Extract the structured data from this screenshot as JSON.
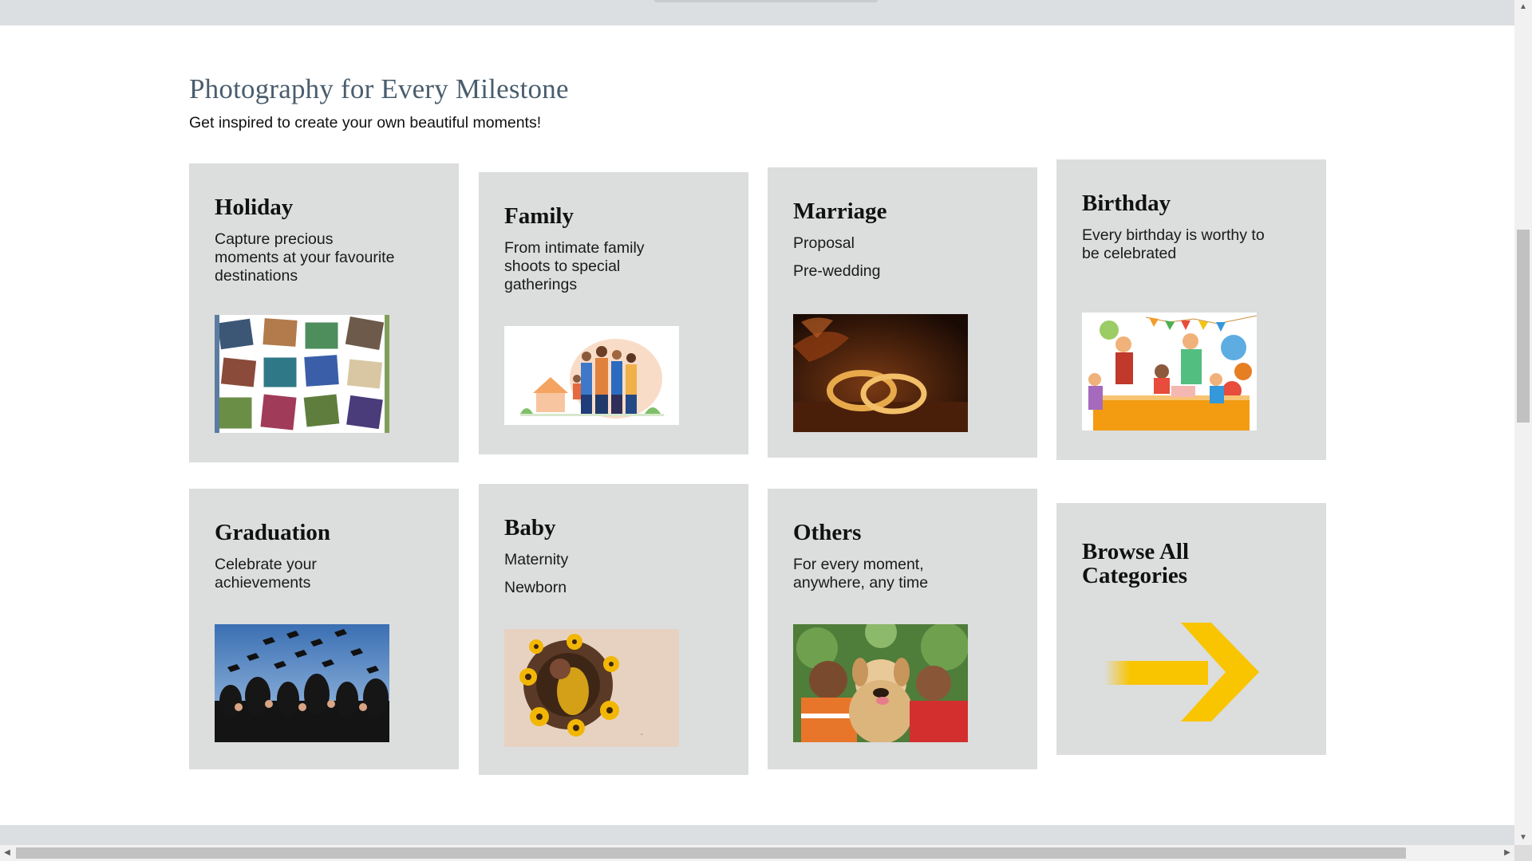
{
  "section": {
    "title": "Photography for Every Milestone",
    "subtitle": "Get inspired to create your own beautiful moments!"
  },
  "cards": [
    {
      "title": "Holiday",
      "description": "Capture precious moments at your favourite destinations",
      "image": "travel-polaroid-collage"
    },
    {
      "title": "Family",
      "description": "From intimate family shoots to special gatherings",
      "image": "family-illustration"
    },
    {
      "title": "Marriage",
      "lines": [
        "Proposal",
        "Pre-wedding"
      ],
      "image": "wedding-rings-photo"
    },
    {
      "title": "Birthday",
      "description": "Every birthday is worthy to be celebrated",
      "image": "birthday-party-illustration"
    },
    {
      "title": "Graduation",
      "description": "Celebrate your achievements",
      "image": "graduation-caps-photo"
    },
    {
      "title": "Baby",
      "lines": [
        "Maternity",
        "Newborn"
      ],
      "image": "newborn-sunflowers-photo"
    },
    {
      "title": "Others",
      "description": "For every moment, anywhere, any time",
      "image": "kids-with-dog-photo"
    },
    {
      "title": "Browse All Categories",
      "image": "arrow-right-icon"
    }
  ],
  "colors": {
    "card_bg": "#dcdddd",
    "title_color": "#4a5d6e",
    "arrow_yellow": "#f9c400"
  },
  "scrollbar": {
    "up_arrow": "▲",
    "down_arrow": "▼",
    "left_arrow": "◀",
    "right_arrow": "▶"
  }
}
